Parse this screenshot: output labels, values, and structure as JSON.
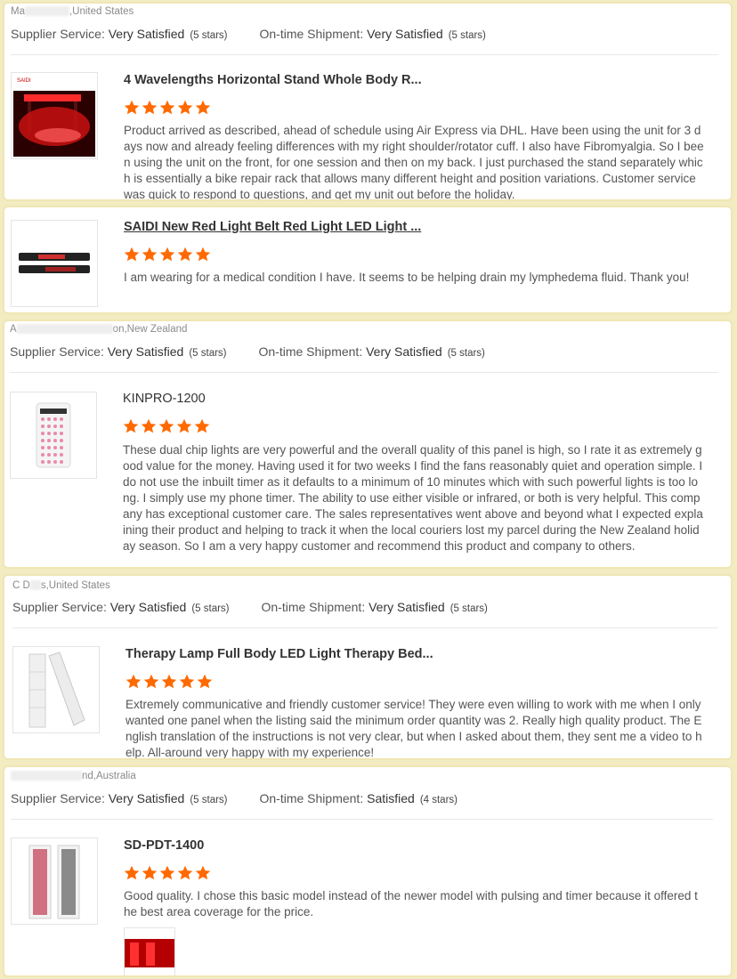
{
  "accent_star_color": "#ff6a00",
  "labels": {
    "supplier_service": "Supplier Service:",
    "ontime_shipment": "On-time Shipment:"
  },
  "reviews": [
    {
      "buyer_prefix": "Ma",
      "buyer_country": ",United States",
      "supplier_value": "Very Satisfied",
      "supplier_stars": "(5 stars)",
      "shipment_value": "Very Satisfied",
      "shipment_stars": "(5 stars)",
      "product": {
        "title": "4 Wavelengths Horizontal Stand Whole Body R...",
        "rating": 5,
        "text": "Product arrived as described, ahead of schedule using Air Express via DHL. Have been using the unit for 3 days now and already feeling differences with my right shoulder/rotator cuff.  I also have Fibromyalgia. So I been using the unit on the front, for one session and then on my back. I just purchased the stand separately which is essentially a bike repair rack that allows many different height and position variations. Customer service was quick to respond to questions, and get my unit out before the holiday."
      }
    },
    {
      "product": {
        "title": "SAIDI New Red Light Belt Red Light LED Light ...",
        "rating": 5,
        "text": "I am wearing for a medical condition I have. It seems to be helping drain my lymphedema fluid. Thank you!"
      }
    },
    {
      "buyer_prefix": "A",
      "buyer_country": "on,New Zealand",
      "supplier_value": "Very Satisfied",
      "supplier_stars": "(5 stars)",
      "shipment_value": "Very Satisfied",
      "shipment_stars": "(5 stars)",
      "product": {
        "title": "KINPRO-1200",
        "rating": 5,
        "text": "These dual chip lights are very powerful and the overall quality of this panel is high, so I rate it as extremely good value for the money. Having used it for two weeks I find the fans reasonably quiet and operation simple. I do not use the inbuilt timer as it defaults to a minimum of 10 minutes which with such powerful lights is too long. I simply use my phone timer. The ability to use either visible or infrared, or both is very helpful. This company has exceptional customer care. The sales representatives went above and beyond what I expected explaining their product and helping to track it when the local couriers lost my parcel during the New Zealand holiday season. So I am a very happy customer and recommend this product and company to others."
      }
    },
    {
      "buyer_prefix": "C D",
      "buyer_country": "s,United States",
      "supplier_value": "Very Satisfied",
      "supplier_stars": "(5 stars)",
      "shipment_value": "Very Satisfied",
      "shipment_stars": "(5 stars)",
      "product": {
        "title": "Therapy Lamp Full Body LED Light Therapy Bed...",
        "rating": 5,
        "text": "Extremely communicative and friendly customer service! They were even willing to work with me when I only wanted one panel when the listing said the minimum order quantity was 2. Really high quality product. The English translation of the instructions is not very clear, but when I asked about them, they sent me a video to help. All-around very happy with my experience!"
      }
    },
    {
      "buyer_prefix": "",
      "buyer_country": "nd,Australia",
      "supplier_value": "Very Satisfied",
      "supplier_stars": "(5 stars)",
      "shipment_value": "Satisfied",
      "shipment_stars": "(4 stars)",
      "product": {
        "title": "SD-PDT-1400",
        "rating": 5,
        "text": "Good quality. I chose this basic model instead of the newer model with pulsing and timer because it offered the best area coverage for the price."
      }
    }
  ]
}
